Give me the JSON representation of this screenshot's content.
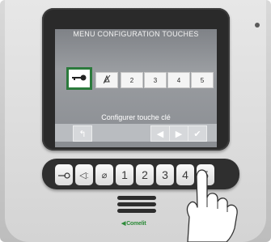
{
  "screen": {
    "title": "MENU CONFIGURATION TOUCHES",
    "info_line": "Configurer touche clé",
    "key_slots": [
      {
        "label": "⊸",
        "icon": "key-icon",
        "selected": true
      },
      {
        "label": "⊄",
        "icon": "mute-icon",
        "selected": false
      },
      {
        "label": "2",
        "selected": false
      },
      {
        "label": "3",
        "selected": false
      },
      {
        "label": "4",
        "selected": false
      },
      {
        "label": "5",
        "selected": false
      }
    ],
    "nav_buttons": [
      {
        "label": "↰",
        "icon": "back-icon"
      },
      {
        "label": "◀",
        "icon": "left-arrow-icon"
      },
      {
        "label": "▶",
        "icon": "right-arrow-icon"
      },
      {
        "label": "✔",
        "icon": "check-icon"
      }
    ]
  },
  "hardware_buttons": [
    {
      "label": "⊸",
      "icon": "key-icon"
    },
    {
      "label": "◁ː",
      "icon": "speaker-mute-icon"
    },
    {
      "label": "⌀",
      "icon": "bell-off-icon"
    },
    {
      "label": "1"
    },
    {
      "label": "2"
    },
    {
      "label": "3"
    },
    {
      "label": "4"
    },
    {
      "label": "5"
    }
  ],
  "brand": {
    "name": "Comelit"
  },
  "colors": {
    "selection": "#2b7a3c",
    "brand": "#2e8b3a"
  }
}
